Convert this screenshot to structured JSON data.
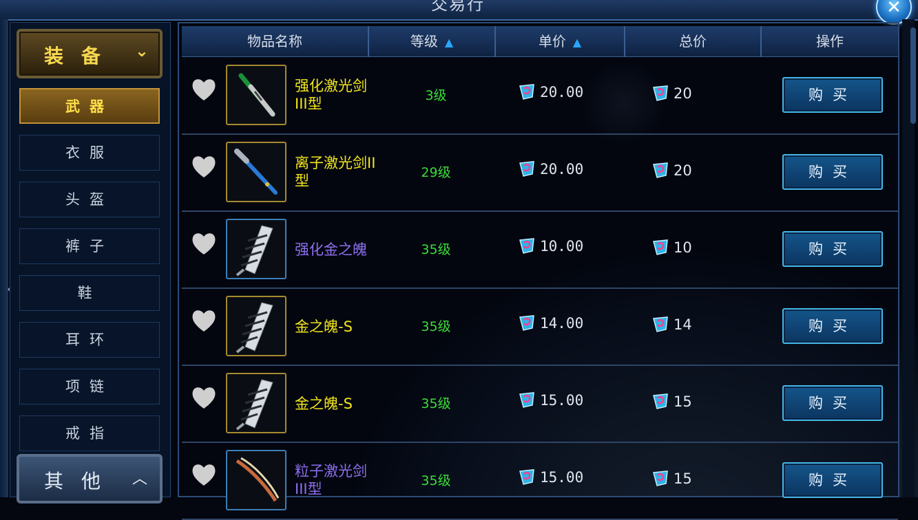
{
  "window": {
    "title": "交易行",
    "close_icon": "close-icon"
  },
  "sidebar": {
    "category": {
      "label": "装备",
      "icon": "chevron-down-icon"
    },
    "items": [
      {
        "label": "武器",
        "active": true
      },
      {
        "label": "衣服"
      },
      {
        "label": "头盔"
      },
      {
        "label": "裤子"
      },
      {
        "label": "鞋"
      },
      {
        "label": "耳环"
      },
      {
        "label": "项链"
      },
      {
        "label": "戒指"
      }
    ],
    "other_category": {
      "label": "其他",
      "icon": "chevron-up-icon"
    }
  },
  "table": {
    "headers": {
      "name": "物品名称",
      "level": "等级",
      "unit_price": "单价",
      "total_price": "总价",
      "action": "操作"
    },
    "rows": [
      {
        "name": "强化激光剑III型",
        "name_color": "#f2e51c",
        "level": "3级",
        "unit_price": "20.00",
        "total": "20",
        "button": "购买",
        "icon": "lightsaber-green-icon",
        "frame": "gold"
      },
      {
        "name": "离子激光剑II型",
        "name_color": "#f2e51c",
        "level": "29级",
        "unit_price": "20.00",
        "total": "20",
        "button": "购买",
        "icon": "lightsaber-blue-icon",
        "frame": "gold"
      },
      {
        "name": "强化金之魄",
        "name_color": "#8e6ff0",
        "level": "35级",
        "unit_price": "10.00",
        "total": "10",
        "button": "购买",
        "icon": "metal-claw-icon",
        "frame": "blue"
      },
      {
        "name": "金之魄-S",
        "name_color": "#f2e51c",
        "level": "35级",
        "unit_price": "14.00",
        "total": "14",
        "button": "购买",
        "icon": "metal-claw-icon",
        "frame": "gold"
      },
      {
        "name": "金之魄-S",
        "name_color": "#f2e51c",
        "level": "35级",
        "unit_price": "15.00",
        "total": "15",
        "button": "购买",
        "icon": "metal-claw-icon",
        "frame": "gold"
      },
      {
        "name": "粒子激光剑III型",
        "name_color": "#8e6ff0",
        "level": "35级",
        "unit_price": "15.00",
        "total": "15",
        "button": "购买",
        "icon": "lightsaber-red-icon",
        "frame": "blue"
      }
    ]
  },
  "colors": {
    "level": "#3fdc3a",
    "accent": "#29a7ff",
    "gold_text": "#f7d74f"
  }
}
